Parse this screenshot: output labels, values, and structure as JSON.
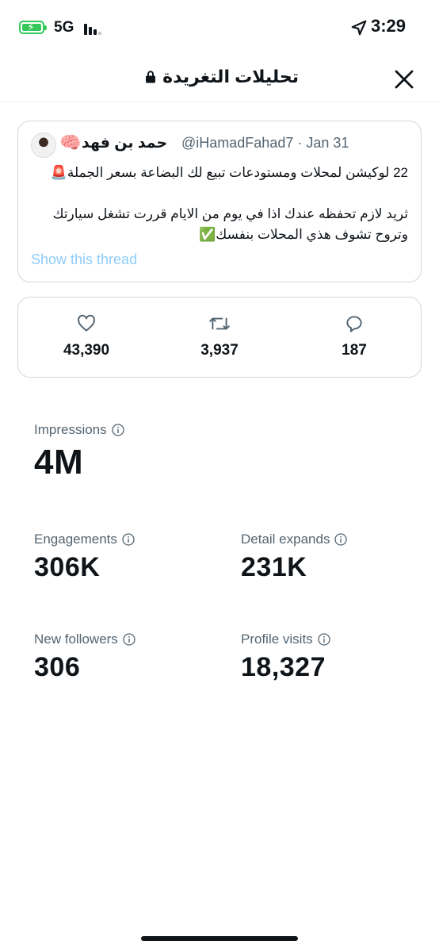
{
  "status_bar": {
    "network": "5G",
    "time": "3:29"
  },
  "header": {
    "title": "تحليلات التغريدة",
    "close_icon": "close-icon",
    "lock_icon": "lock-icon"
  },
  "tweet": {
    "name": "حمد بن فهد",
    "emoji": "🧠",
    "handle_date": "@iHamadFahad7 · Jan 31",
    "text": "22 لوكيشن لمحلات ومستودعات تبيع لك البضاعة بسعر الجملة🚨\n\nثريد لازم تحفظه عندك اذا في يوم من الايام قررت تشغل سيارتك وتروح تشوف هذي المحلات بنفسك✅",
    "show_thread": "Show this thread"
  },
  "engagement": {
    "likes": "43,390",
    "retweets": "3,937",
    "replies": "187"
  },
  "stats": {
    "impressions": {
      "label": "Impressions",
      "value": "4M"
    },
    "engagements": {
      "label": "Engagements",
      "value": "306K"
    },
    "detail_expands": {
      "label": "Detail expands",
      "value": "231K"
    },
    "new_followers": {
      "label": "New followers",
      "value": "306"
    },
    "profile_visits": {
      "label": "Profile visits",
      "value": "18,327"
    }
  },
  "colors": {
    "accent_link": "#8ecdf8",
    "battery": "#34c759",
    "muted": "#536471",
    "border": "#cfd9de"
  }
}
